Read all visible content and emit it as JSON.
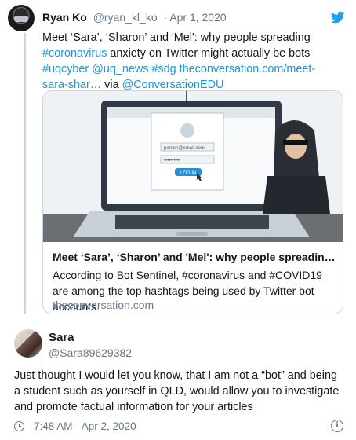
{
  "quoted": {
    "name": "Ryan Ko",
    "handle": "@ryan_kl_ko",
    "date": "· Apr 1, 2020",
    "text_parts": [
      {
        "t": "Meet ‘Sara’, ‘Sharon’ and 'Mel': why people spreading ",
        "link": false
      },
      {
        "t": "#coronavirus",
        "link": true
      },
      {
        "t": " anxiety on Twitter might actually be bots ",
        "link": false
      },
      {
        "t": "#uqcyber",
        "link": true
      },
      {
        "t": " ",
        "link": false
      },
      {
        "t": "@uq_news",
        "link": true
      },
      {
        "t": " ",
        "link": false
      },
      {
        "t": "#sdg",
        "link": true
      },
      {
        "t": " ",
        "link": false
      },
      {
        "t": "theconversation.com/meet-sara-shar…",
        "link": true
      },
      {
        "t": " via ",
        "link": false
      },
      {
        "t": "@ConversationEDU",
        "link": true
      }
    ],
    "card": {
      "image_labels": {
        "field1": "person@email.com",
        "field2": "••••••••••",
        "button": "LOG IN"
      },
      "title": "Meet ‘Sara’, ‘Sharon’ and 'Mel': why people spreading c…",
      "description": "According to Bot Sentinel, #coronavirus and #COVID19 are among the top hashtags being used by Twitter bot accounts.",
      "domain": "theconversation.com"
    }
  },
  "reply": {
    "name": "Sara",
    "handle": "@Sara89629382",
    "text": "Just thought I would let you know, that I am not a “bot” and being a student such as yourself in QLD, would allow you to investigate and promote factual information for your articles",
    "timestamp": "7:48 AM - Apr 2, 2020",
    "info_glyph": "i"
  },
  "icons": [
    "twitter-bird-icon",
    "clock-icon",
    "info-icon"
  ],
  "colors": {
    "link": "#1b95e0",
    "muted": "#657786",
    "border": "#ccd6dd",
    "text": "#14171a"
  }
}
